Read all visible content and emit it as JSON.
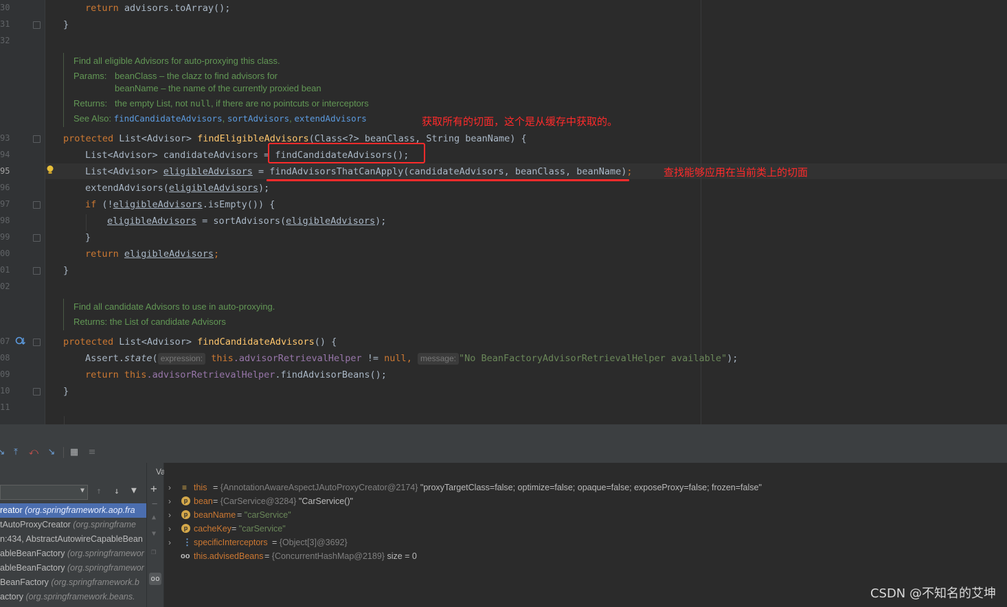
{
  "editor": {
    "line_numbers": [
      "30",
      "31",
      "32",
      "93",
      "94",
      "95",
      "96",
      "97",
      "98",
      "99",
      "00",
      "01",
      "02",
      "07",
      "08",
      "09",
      "10",
      "11"
    ],
    "code": {
      "l30": {
        "kw": "return",
        "text": " advisors.toArray();"
      },
      "l31": "}",
      "doc1": {
        "summary": "Find all eligible Advisors for auto-proxying this class.",
        "params_label": "Params:",
        "param1": "beanClass – the clazz to find advisors for",
        "param2": "beanName – the name of the currently proxied bean",
        "returns_label": "Returns:",
        "returns_pre": "the empty List, not ",
        "returns_null": "null",
        "returns_post": ", if there are no pointcuts or interceptors",
        "see_label": "See Also:",
        "see_links": [
          "findCandidateAdvisors",
          "sortAdvisors",
          "extendAdvisors"
        ]
      },
      "l93": {
        "kw": "protected",
        "type": " List<Advisor> ",
        "fn": "findEligibleAdvisors",
        "params": "(Class<?> beanClass, String beanName) {"
      },
      "l94": {
        "pre": "List<Advisor> candidateAdvisors = ",
        "call": "findCandidateAdvisors();"
      },
      "l95": {
        "pre": "List<Advisor> ",
        "var": "eligibleAdvisors",
        "mid": " = ",
        "call": "findAdvisorsThatCanApply(candidateAdvisors, beanClass, beanName)",
        "end": ";"
      },
      "l96": {
        "pre": "extendAdvisors(",
        "var": "eligibleAdvisors",
        "end": ");"
      },
      "l97": {
        "kw": "if",
        "pre": " (!",
        "var": "eligibleAdvisors",
        "end": ".isEmpty()) {"
      },
      "l98": {
        "var1": "eligibleAdvisors",
        "mid": " = sortAdvisors(",
        "var2": "eligibleAdvisors",
        "end": ");"
      },
      "l99": "}",
      "l00": {
        "kw": "return",
        "var": "eligibleAdvisors",
        "end": ";"
      },
      "l01": "}",
      "doc2": {
        "summary": "Find all candidate Advisors to use in auto-proxying.",
        "returns": "Returns: the List of candidate Advisors"
      },
      "l07": {
        "kw": "protected",
        "type": " List<Advisor> ",
        "fn": "findCandidateAdvisors",
        "params": "() {"
      },
      "l08": {
        "pre": "Assert.",
        "fn": "state",
        "open": "(",
        "hint1": "expression:",
        "this": "this",
        "field": ".advisorRetrievalHelper",
        "mid": " != ",
        "null_kw": "null",
        "comma": ", ",
        "hint2": "message:",
        "str": "\"No BeanFactoryAdvisorRetrievalHelper available\"",
        "end": ");"
      },
      "l09": {
        "kw": "return",
        "this": "this",
        "field": ".advisorRetrievalHelper",
        "end": ".findAdvisorBeans();"
      },
      "l10": "}"
    },
    "annotations": {
      "a1": "获取所有的切面，这个是从缓存中获取的。",
      "a2": "查找能够应用在当前类上的切面"
    },
    "annotation_color": "#ff2b2b"
  },
  "debug": {
    "toolbar_icons": [
      "step-icon",
      "step-out-icon",
      "drop-frame-icon",
      "run-to-cursor-icon",
      "evaluate-icon",
      "trace-icon"
    ],
    "frames": [
      {
        "method": "reator ",
        "pkg": "(org.springframework.aop.fra",
        "selected": true
      },
      {
        "method": "tAutoProxyCreator ",
        "pkg": "(org.springframe",
        "selected": false
      },
      {
        "method": "n:434, AbstractAutowireCapableBean",
        "pkg": "",
        "selected": false
      },
      {
        "method": "ableBeanFactory ",
        "pkg": "(org.springframewor",
        "selected": false
      },
      {
        "method": "ableBeanFactory ",
        "pkg": "(org.springframewor",
        "selected": false
      },
      {
        "method": "BeanFactory ",
        "pkg": "(org.springframework.b",
        "selected": false
      },
      {
        "method": "actory ",
        "pkg": "(org.springframework.beans.",
        "selected": false
      }
    ],
    "variables_title": "Variables",
    "variables": [
      {
        "name": "this",
        "eq": " = ",
        "type": "{AnnotationAwareAspectJAutoProxyCreator@2174}",
        "value": " \"proxyTargetClass=false; optimize=false; opaque=false; exposeProxy=false; frozen=false\"",
        "icon": "fields-icon",
        "icon_text": "≡"
      },
      {
        "name": "bean",
        "eq": " = ",
        "type": "{CarService@3284}",
        "value": " \"CarService()\"",
        "icon": "parameter-icon",
        "icon_text": "p"
      },
      {
        "name": "beanName",
        "eq": " = ",
        "type": "",
        "value": "\"carService\"",
        "icon": "parameter-icon",
        "icon_text": "p"
      },
      {
        "name": "cacheKey",
        "eq": " = ",
        "type": "",
        "value": "\"carService\"",
        "icon": "parameter-icon",
        "icon_text": "p"
      },
      {
        "name": "specificInterceptors",
        "eq": " = ",
        "type": "{Object[3]@3692}",
        "value": "",
        "icon": "array-icon",
        "icon_text": "⋮"
      },
      {
        "name": "this.advisedBeans",
        "eq": " = ",
        "type": "{ConcurrentHashMap@2189}",
        "value": "  size = 0",
        "icon": "watch-icon",
        "icon_text": "oo"
      }
    ]
  },
  "watermark": "CSDN @不知名的艾坤"
}
